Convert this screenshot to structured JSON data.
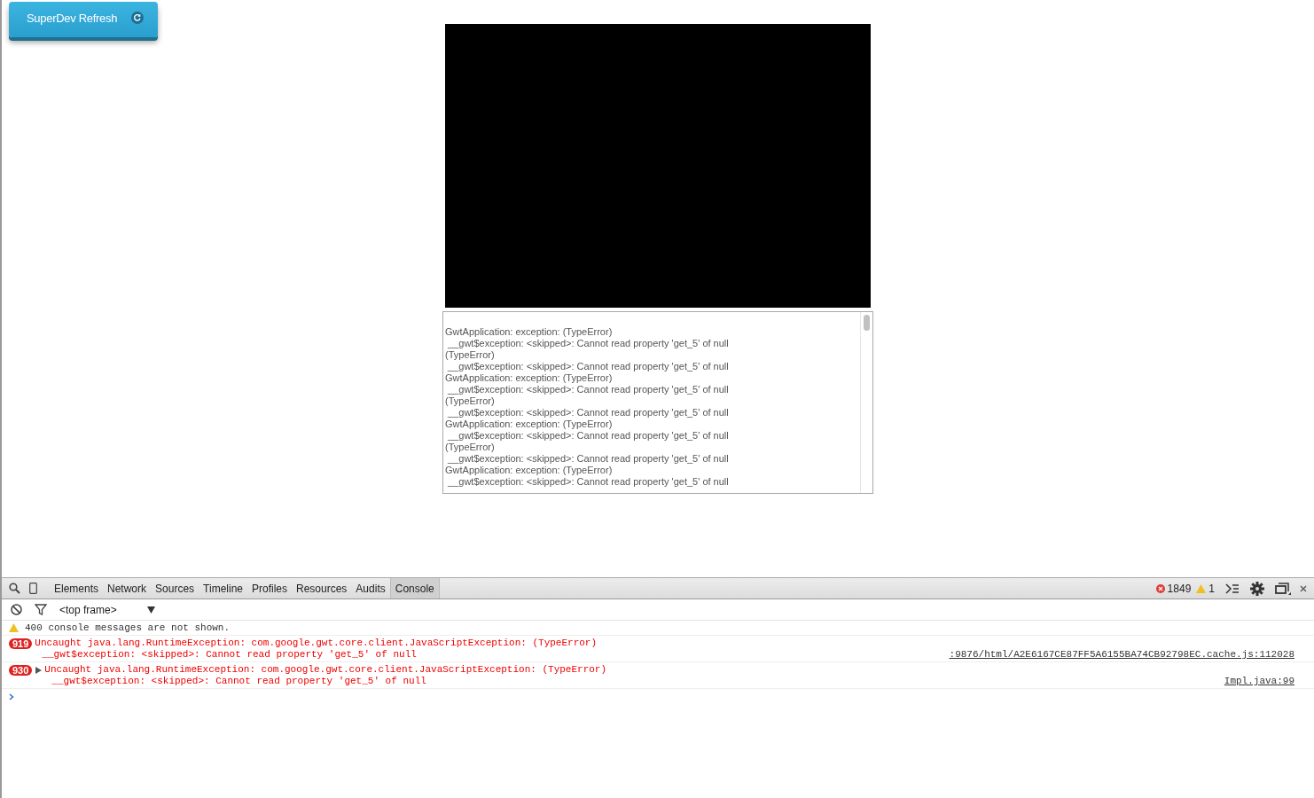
{
  "superdev_button": {
    "label": "SuperDev Refresh"
  },
  "log": {
    "lines": [
      "GwtApplication: exception: (TypeError)",
      " __gwt$exception: <skipped>: Cannot read property 'get_5' of null",
      "(TypeError)",
      " __gwt$exception: <skipped>: Cannot read property 'get_5' of null",
      "GwtApplication: exception: (TypeError)",
      " __gwt$exception: <skipped>: Cannot read property 'get_5' of null",
      "(TypeError)",
      " __gwt$exception: <skipped>: Cannot read property 'get_5' of null",
      "GwtApplication: exception: (TypeError)",
      " __gwt$exception: <skipped>: Cannot read property 'get_5' of null",
      "(TypeError)",
      " __gwt$exception: <skipped>: Cannot read property 'get_5' of null",
      "GwtApplication: exception: (TypeError)",
      " __gwt$exception: <skipped>: Cannot read property 'get_5' of null"
    ]
  },
  "devtools": {
    "tabs": [
      {
        "label": "Elements",
        "selected": false
      },
      {
        "label": "Network",
        "selected": false
      },
      {
        "label": "Sources",
        "selected": false
      },
      {
        "label": "Timeline",
        "selected": false
      },
      {
        "label": "Profiles",
        "selected": false
      },
      {
        "label": "Resources",
        "selected": false
      },
      {
        "label": "Audits",
        "selected": false
      },
      {
        "label": "Console",
        "selected": true
      }
    ],
    "error_count": "1849",
    "warning_count": "1",
    "context": "<top frame>",
    "messages": [
      {
        "kind": "warning",
        "lines": [
          "400 console messages are not shown."
        ]
      },
      {
        "kind": "error",
        "count": "919",
        "expandable": false,
        "lines": [
          "Uncaught java.lang.RuntimeException: com.google.gwt.core.client.JavaScriptException: (TypeError)",
          "__gwt$exception: <skipped>: Cannot read property 'get_5' of null"
        ],
        "source": ":9876/html/A2E6167CE87FF5A6155BA74CB92798EC.cache.js:112028"
      },
      {
        "kind": "error",
        "count": "930",
        "expandable": true,
        "lines": [
          "Uncaught java.lang.RuntimeException: com.google.gwt.core.client.JavaScriptException: (TypeError)",
          "__gwt$exception: <skipped>: Cannot read property 'get_5' of null"
        ],
        "source": "Impl.java:99"
      }
    ]
  }
}
